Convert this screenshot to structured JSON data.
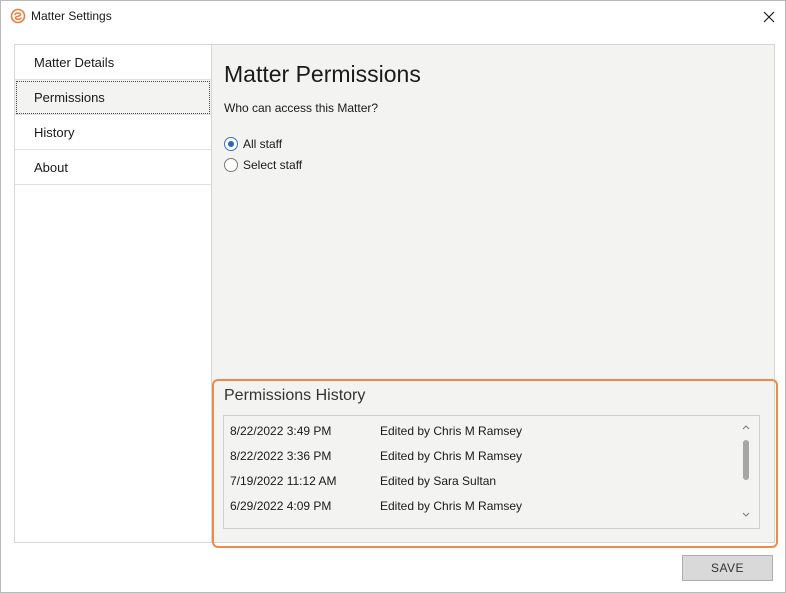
{
  "window": {
    "title": "Matter Settings",
    "app_icon": "smokeball-logo-icon",
    "close_icon": "close-icon",
    "accent_color": "#f08a4b"
  },
  "sidebar": {
    "items": [
      {
        "label": "Matter Details",
        "selected": false
      },
      {
        "label": "Permissions",
        "selected": true
      },
      {
        "label": "History",
        "selected": false
      },
      {
        "label": "About",
        "selected": false
      }
    ]
  },
  "main": {
    "title": "Matter Permissions",
    "question": "Who can access this Matter?",
    "options": [
      {
        "label": "All staff",
        "checked": true
      },
      {
        "label": "Select staff",
        "checked": false
      }
    ]
  },
  "history": {
    "title": "Permissions History",
    "highlight_color": "#f08a4b",
    "rows": [
      {
        "date": "8/22/2022 3:49 PM",
        "desc": "Edited by Chris M Ramsey"
      },
      {
        "date": "8/22/2022 3:36 PM",
        "desc": "Edited by Chris M Ramsey"
      },
      {
        "date": "7/19/2022 11:12 AM",
        "desc": "Edited by Sara Sultan"
      },
      {
        "date": "6/29/2022 4:09 PM",
        "desc": "Edited by Chris M Ramsey"
      }
    ]
  },
  "footer": {
    "save_label": "SAVE"
  }
}
